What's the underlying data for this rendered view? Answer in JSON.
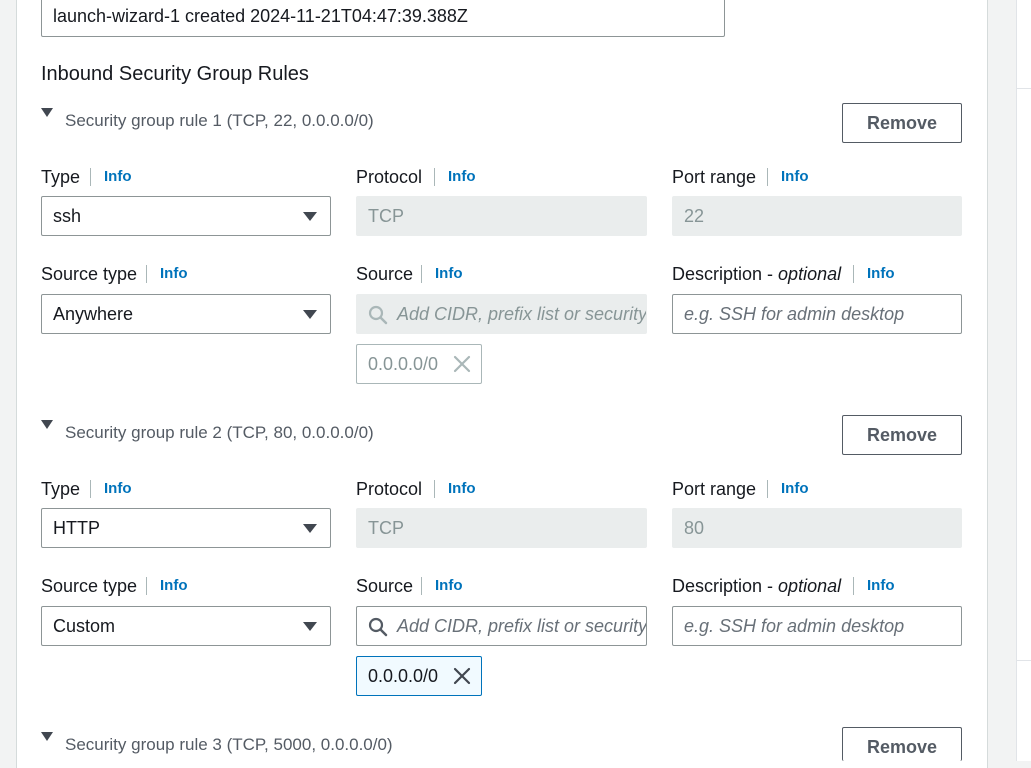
{
  "security_group": {
    "description_value": "launch-wizard-1 created 2024-11-21T04:47:39.388Z"
  },
  "inbound": {
    "heading": "Inbound Security Group Rules",
    "labels": {
      "type": "Type",
      "protocol": "Protocol",
      "port_range": "Port range",
      "source_type": "Source type",
      "source": "Source",
      "description": "Description",
      "description_optional": "optional",
      "description_dash": " - ",
      "info": "Info",
      "remove": "Remove"
    },
    "source_placeholder": "Add CIDR, prefix list or security",
    "description_placeholder": "e.g. SSH for admin desktop",
    "rules": [
      {
        "title": "Security group rule 1 (TCP, 22, 0.0.0.0/0)",
        "type": "ssh",
        "protocol": "TCP",
        "port_range": "22",
        "source_type": "Anywhere",
        "source_token": "0.0.0.0/0",
        "source_disabled": true
      },
      {
        "title": "Security group rule 2 (TCP, 80, 0.0.0.0/0)",
        "type": "HTTP",
        "protocol": "TCP",
        "port_range": "80",
        "source_type": "Custom",
        "source_token": "0.0.0.0/0",
        "source_disabled": false
      },
      {
        "title": "Security group rule 3 (TCP, 5000, 0.0.0.0/0)"
      }
    ]
  },
  "colors": {
    "info_link": "#0073bb",
    "disabled_field": "#eaeded",
    "active_token_border": "#0073bb"
  },
  "icons": {
    "expand": "caret-down-icon",
    "select": "chevron-down-icon",
    "search": "search-icon",
    "dismiss": "close-icon"
  }
}
